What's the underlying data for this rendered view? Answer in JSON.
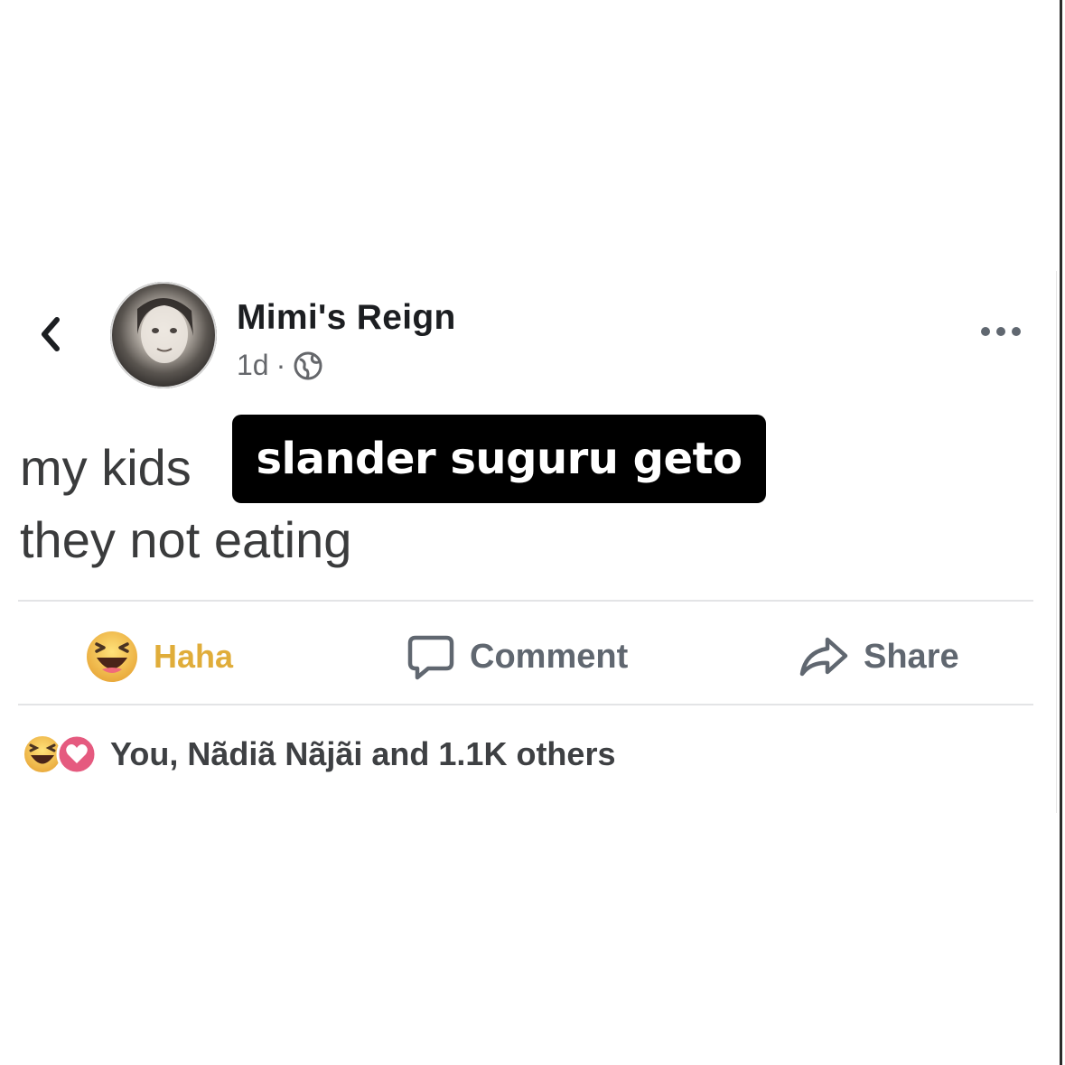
{
  "post": {
    "author": "Mimi's Reign",
    "time": "1d",
    "separator": "·",
    "text_line1": "my kids",
    "text_line2": "they not eating",
    "overlay": "slander suguru geto"
  },
  "actions": {
    "haha": "Haha",
    "comment": "Comment",
    "share": "Share"
  },
  "reactions": {
    "summary": "You, Nãdiã Nãjãi and 1.1K others"
  },
  "icons": {
    "back": "chevron-left-icon",
    "more": "more-dots-icon",
    "audience": "globe-icon",
    "haha": "haha-emoji-icon",
    "comment": "comment-bubble-icon",
    "share": "share-arrow-icon",
    "love": "love-reaction-icon"
  },
  "colors": {
    "haha_yellow": "#e0ad3a",
    "love_pink": "#e55a7f",
    "overlay_bg": "#000000",
    "muted_text": "#606770"
  }
}
